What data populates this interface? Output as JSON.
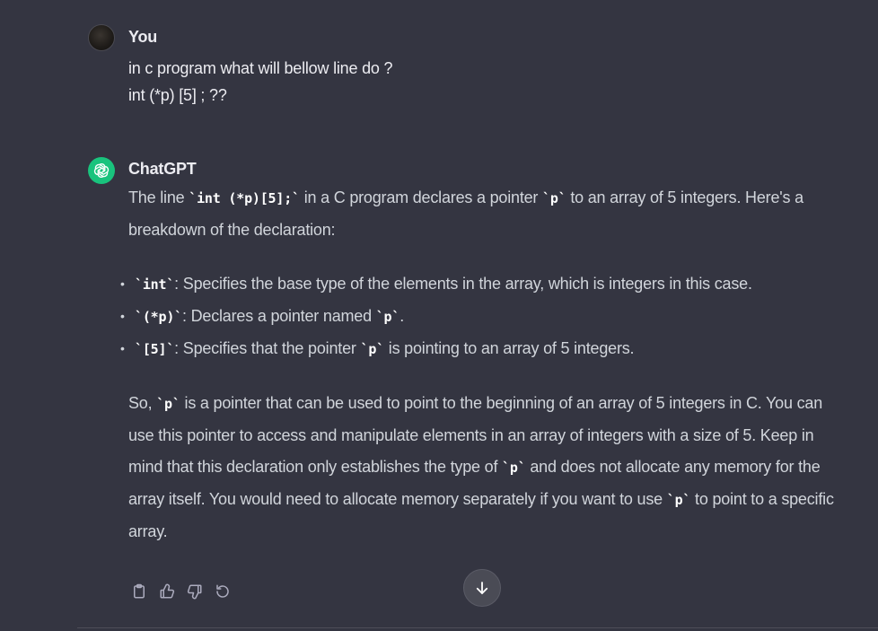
{
  "user_message": {
    "author": "You",
    "lines": [
      "in c program what will bellow line do ?",
      "int (*p) [5] ; ??"
    ]
  },
  "assistant_message": {
    "author": "ChatGPT",
    "intro": {
      "t1": "The line ",
      "c1": "`int (*p)[5];`",
      "t2": " in a C program declares a pointer ",
      "c2": "`p`",
      "t3": " to an array of 5 integers. Here's a breakdown of the declaration:"
    },
    "bullets": [
      {
        "code": "`int`",
        "text": ": Specifies the base type of the elements in the array, which is integers in this case."
      },
      {
        "code": "`(*p)`",
        "text": ": Declares a pointer named ",
        "code2": "`p`",
        "text2": "."
      },
      {
        "code": "`[5]`",
        "text": ": Specifies that the pointer ",
        "code2": "`p`",
        "text2": " is pointing to an array of 5 integers."
      }
    ],
    "summary": {
      "t1": "So, ",
      "c1": "`p`",
      "t2": " is a pointer that can be used to point to the beginning of an array of 5 integers in C. You can use this pointer to access and manipulate elements in an array of integers with a size of 5. Keep in mind that this declaration only establishes the type of ",
      "c2": "`p`",
      "t3": " and does not allocate any memory for the array itself. You would need to allocate memory separately if you want to use ",
      "c3": "`p`",
      "t4": " to point to a specific array."
    }
  },
  "actions": {
    "icons": [
      "clipboard-icon",
      "thumbs-up-icon",
      "thumbs-down-icon",
      "regenerate-icon"
    ]
  },
  "scroll_button": {
    "icon": "arrow-down-icon"
  },
  "colors": {
    "background": "#343541",
    "text": "#ececf1",
    "body_text": "#d1d5db",
    "gpt_avatar": "#19c37d"
  }
}
